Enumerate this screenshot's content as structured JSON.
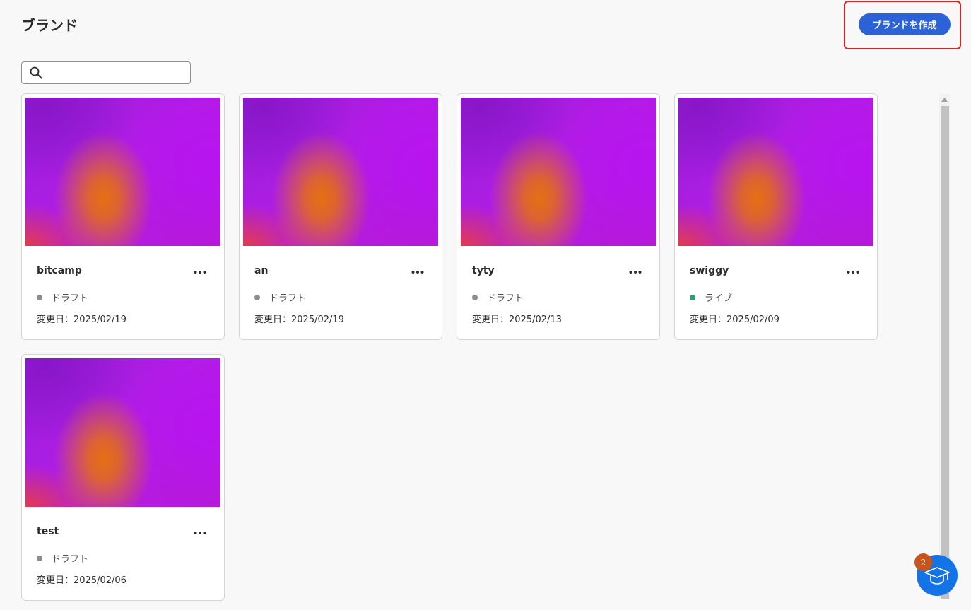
{
  "header": {
    "title": "ブランド",
    "create_button_label": "ブランドを作成"
  },
  "search": {
    "placeholder": "",
    "value": ""
  },
  "colors": {
    "accent": "#2b62d6",
    "highlight": "#e01e1e",
    "status_draft": "#8e8e8e",
    "status_live": "#2d9d78",
    "help_button": "#1473e6",
    "badge": "#c9541a"
  },
  "cards": [
    {
      "name": "bitcamp",
      "status": "ドラフト",
      "status_type": "draft",
      "modified": "変更日：2025/02/19"
    },
    {
      "name": "an",
      "status": "ドラフト",
      "status_type": "draft",
      "modified": "変更日：2025/02/19"
    },
    {
      "name": "tyty",
      "status": "ドラフト",
      "status_type": "draft",
      "modified": "変更日：2025/02/13"
    },
    {
      "name": "swiggy",
      "status": "ライブ",
      "status_type": "live",
      "modified": "変更日：2025/02/09"
    },
    {
      "name": "test",
      "status": "ドラフト",
      "status_type": "draft",
      "modified": "変更日：2025/02/06"
    }
  ],
  "help": {
    "badge_count": "2",
    "icon": "graduation-cap-icon"
  }
}
